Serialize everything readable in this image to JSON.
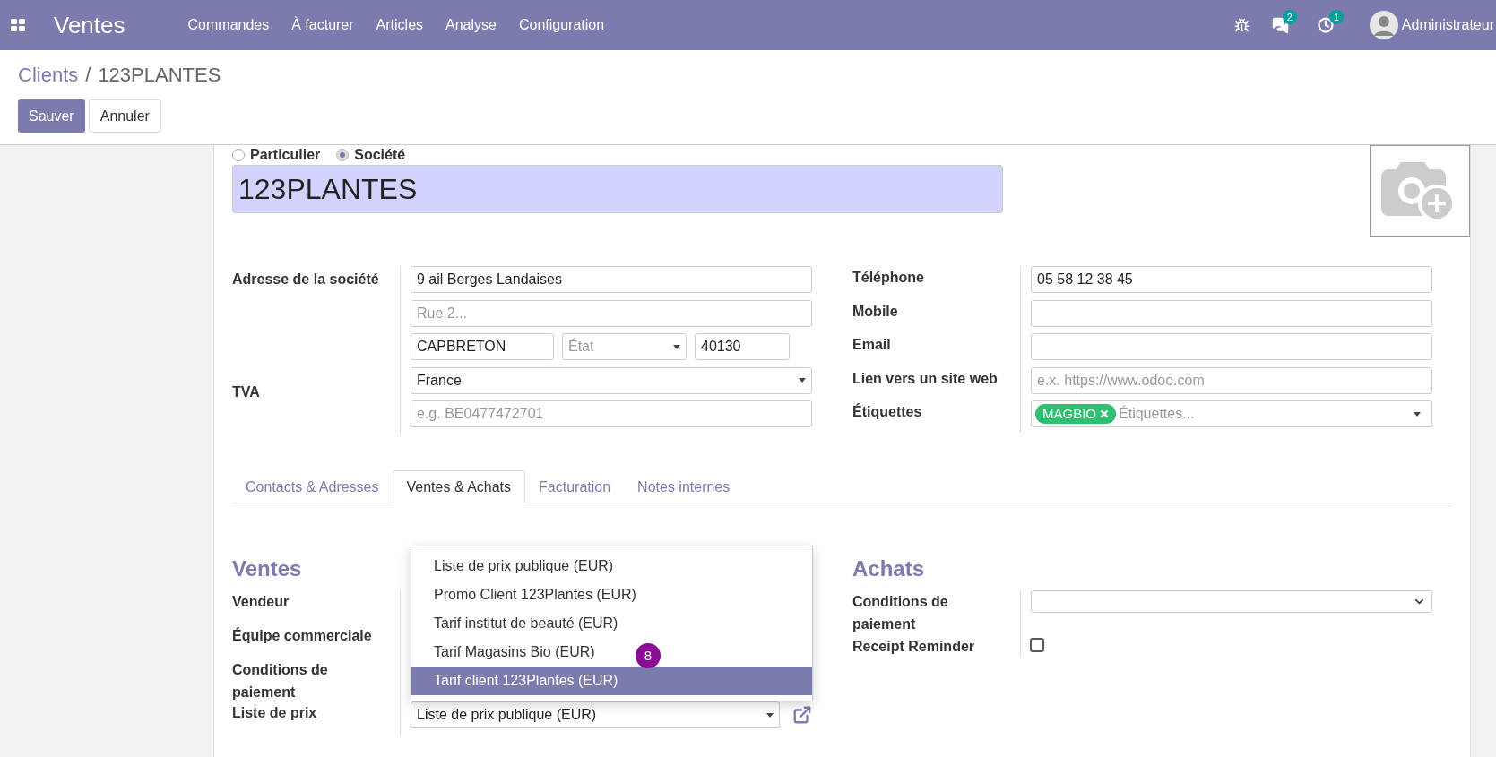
{
  "navbar": {
    "app": "Ventes",
    "menu": [
      "Commandes",
      "À facturer",
      "Articles",
      "Analyse",
      "Configuration"
    ],
    "messages_count": "2",
    "activities_count": "1",
    "user": "Administrateur"
  },
  "breadcrumb": {
    "parent": "Clients",
    "separator": "/",
    "current": "123PLANTES"
  },
  "buttons": [
    {
      "label": "Sauver",
      "kind": "primary"
    },
    {
      "label": "Annuler",
      "kind": "secondary"
    }
  ],
  "company_type": [
    {
      "label": "Particulier",
      "selected": false
    },
    {
      "label": "Société",
      "selected": true
    }
  ],
  "name": "123PLANTES",
  "address": {
    "label": "Adresse de la société",
    "street": {
      "value": "9 ail Berges Landaises"
    },
    "street2": {
      "placeholder": "Rue 2..."
    },
    "city": {
      "value": "CAPBRETON"
    },
    "state": {
      "placeholder": "État"
    },
    "zip": {
      "value": "40130"
    },
    "country": {
      "value": "France"
    }
  },
  "vat": {
    "label": "TVA",
    "placeholder": "e.g. BE0477472701"
  },
  "contact_fields": [
    {
      "label": "Téléphone",
      "kind": "input",
      "value": "05 58 12 38 45"
    },
    {
      "label": "Mobile",
      "kind": "input"
    },
    {
      "label": "Email",
      "kind": "input"
    },
    {
      "label": "Lien vers un site web",
      "kind": "input",
      "placeholder": "e.x. https://www.odoo.com"
    },
    {
      "label": "Étiquettes",
      "kind": "tags",
      "tags": [
        "MAGBIO"
      ],
      "placeholder": "Étiquettes..."
    }
  ],
  "tabs": [
    {
      "label": "Contacts & Adresses",
      "selected": false
    },
    {
      "label": "Ventes & Achats",
      "selected": true
    },
    {
      "label": "Facturation",
      "selected": false
    },
    {
      "label": "Notes internes",
      "selected": false
    }
  ],
  "sales": {
    "title": "Ventes",
    "labels": [
      "Vendeur",
      "Équipe commerciale",
      "Conditions de paiement"
    ],
    "pricelist": {
      "label": "Liste de prix",
      "value": "Liste de prix publique (EUR)"
    },
    "options": [
      {
        "label": "Liste de prix publique (EUR)",
        "selected": false
      },
      {
        "label": "Promo Client 123Plantes (EUR)",
        "selected": false
      },
      {
        "label": "Tarif institut de beauté (EUR)",
        "selected": false
      },
      {
        "label": "Tarif Magasins Bio (EUR)",
        "selected": false
      },
      {
        "label": "Tarif client 123Plantes (EUR)",
        "selected": true
      }
    ],
    "step_badge": "8"
  },
  "purchase": {
    "title": "Achats",
    "payment_terms_label": "Conditions de paiement",
    "receipt_reminder": {
      "label": "Receipt Reminder",
      "checked": false
    }
  }
}
